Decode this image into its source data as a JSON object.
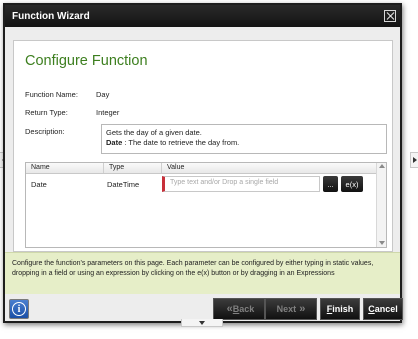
{
  "window": {
    "title": "Function Wizard"
  },
  "page": {
    "heading": "Configure Function"
  },
  "fields": {
    "name_label": "Function Name:",
    "name_value": "Day",
    "return_label": "Return Type:",
    "return_value": "Integer",
    "description_label": "Description:"
  },
  "description": {
    "line1": "Gets the day of a given date.",
    "param_name": "Date",
    "param_desc": " : The date to retrieve the day from."
  },
  "grid": {
    "headers": [
      "Name",
      "Type",
      "Value"
    ],
    "rows": [
      {
        "name": "Date",
        "type": "DateTime",
        "placeholder": "Type text and/or Drop a single field"
      }
    ],
    "browse_label": "...",
    "expr_label": "e(x)"
  },
  "help_text": "Configure the function's parameters on this page. Each parameter can be configured by either typing in static values, dropping in a field or using an expression by clicking on the e(x) button or by dragging in an Expressions",
  "footer": {
    "info_icon": "i",
    "back_prefix": "«",
    "back_accel": "B",
    "back_rest": "ack",
    "next_label": "Next",
    "next_suffix": "»",
    "finish_accel": "F",
    "finish_rest": "inish",
    "cancel_accel": "C",
    "cancel_rest": "ancel"
  },
  "icons": {
    "close": "close-icon",
    "info": "info-icon",
    "left_arrow": "arrow-left-icon",
    "right_arrow": "arrow-right-icon",
    "down_arrow": "arrow-down-icon"
  },
  "colors": {
    "heading": "#3d7f1f",
    "required_marker": "#c8303a",
    "help_background": "#e6eec8",
    "info_button": "#1a4fa6"
  }
}
